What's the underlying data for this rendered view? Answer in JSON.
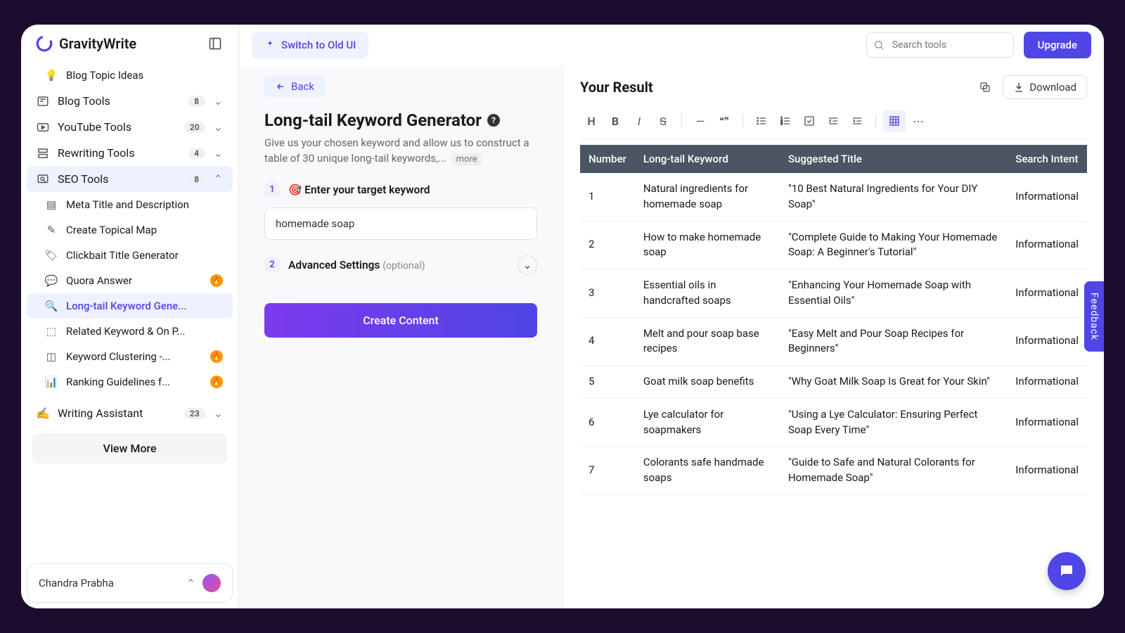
{
  "brand": "GravityWrite",
  "switch_btn": "Switch to Old UI",
  "search_placeholder": "Search tools",
  "upgrade_btn": "Upgrade",
  "sidebar": {
    "top_item": "Blog Topic Ideas",
    "groups": [
      {
        "label": "Blog Tools",
        "count": "8"
      },
      {
        "label": "YouTube Tools",
        "count": "20"
      },
      {
        "label": "Rewriting Tools",
        "count": "4"
      },
      {
        "label": "SEO Tools",
        "count": "8"
      }
    ],
    "seo_children": [
      {
        "label": "Meta Title and Description"
      },
      {
        "label": "Create Topical Map"
      },
      {
        "label": "Clickbait Title Generator"
      },
      {
        "label": "Quora Answer",
        "fire": true
      },
      {
        "label": "Long-tail Keyword Gene...",
        "active": true
      },
      {
        "label": "Related Keyword & On P..."
      },
      {
        "label": "Keyword Clustering -...",
        "fire": true
      },
      {
        "label": "Ranking Guidelines f...",
        "fire": true
      }
    ],
    "writing_assistant": {
      "label": "Writing Assistant",
      "count": "23"
    },
    "view_more": "View More"
  },
  "user_name": "Chandra Prabha",
  "form": {
    "back": "Back",
    "title": "Long-tail Keyword Generator",
    "desc": "Give us your chosen keyword and allow us to construct a table of 30 unique long-tail keywords,...",
    "more": "more",
    "step1_label": "🎯 Enter your target keyword",
    "step1_value": "homemade soap",
    "step2_label": "Advanced Settings",
    "step2_opt": "(optional)",
    "create_btn": "Create Content"
  },
  "result": {
    "title": "Your Result",
    "download": "Download",
    "columns": [
      "Number",
      "Long-tail Keyword",
      "Suggested Title",
      "Search Intent"
    ],
    "chart_data": {
      "type": "table",
      "columns": [
        "Number",
        "Long-tail Keyword",
        "Suggested Title",
        "Search Intent"
      ],
      "rows": [
        [
          "1",
          "Natural ingredients for homemade soap",
          "\"10 Best Natural Ingredients for Your DIY Soap\"",
          "Informational"
        ],
        [
          "2",
          "How to make homemade soap",
          "\"Complete Guide to Making Your Homemade Soap: A Beginner's Tutorial\"",
          "Informational"
        ],
        [
          "3",
          "Essential oils in handcrafted soaps",
          "\"Enhancing Your Homemade Soap with Essential Oils\"",
          "Informational"
        ],
        [
          "4",
          "Melt and pour soap base recipes",
          "\"Easy Melt and Pour Soap Recipes for Beginners\"",
          "Informational"
        ],
        [
          "5",
          "Goat milk soap benefits",
          "\"Why Goat Milk Soap Is Great for Your Skin\"",
          "Informational"
        ],
        [
          "6",
          "Lye calculator for soapmakers",
          "\"Using a Lye Calculator: Ensuring Perfect Soap Every Time\"",
          "Informational"
        ],
        [
          "7",
          "Colorants safe handmade soaps",
          "\"Guide to Safe and Natural Colorants for Homemade Soap\"",
          "Informational"
        ]
      ]
    }
  },
  "feedback": "Feedback"
}
